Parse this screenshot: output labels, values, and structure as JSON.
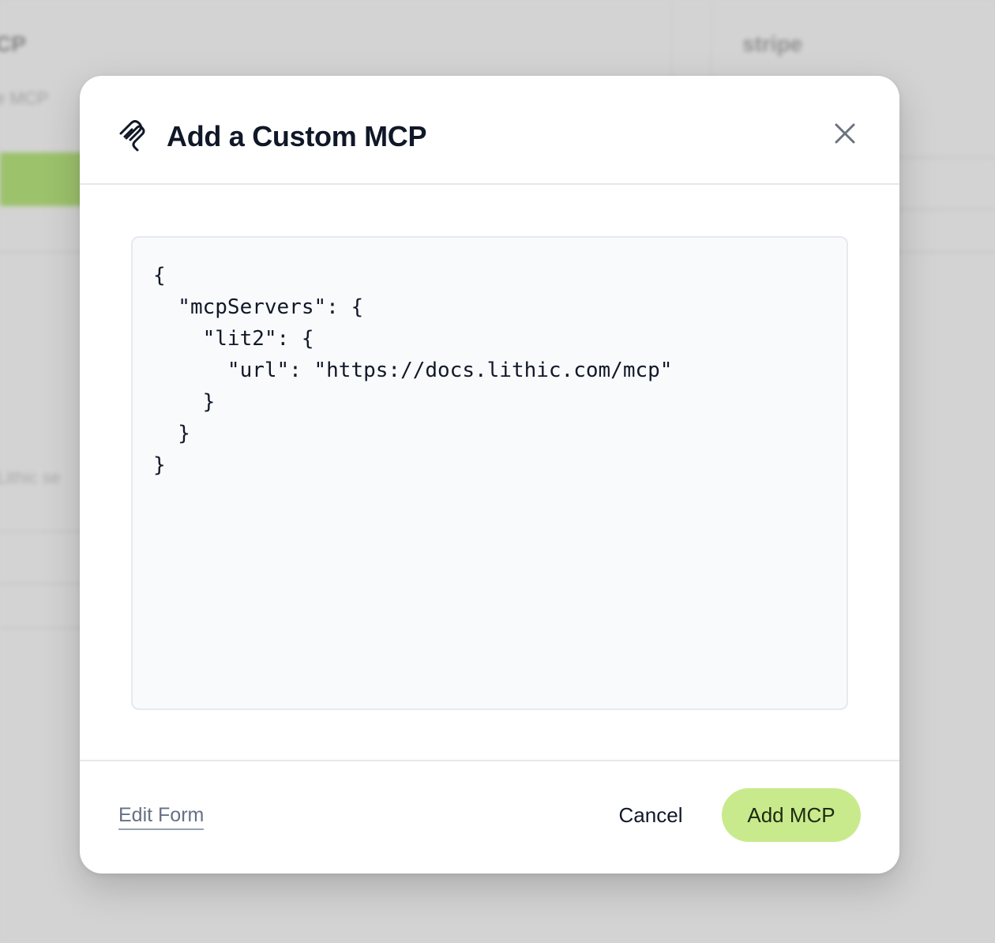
{
  "background": {
    "left_heading": "CP",
    "left_subtext": "e MCP",
    "right_heading": "stripe",
    "faint_text": "Lithic se"
  },
  "modal": {
    "title": "Add a Custom MCP",
    "header_icon": "mcp-logo-icon",
    "close_icon": "close-icon",
    "config_json": "{\n  \"mcpServers\": {\n    \"lit2\": {\n      \"url\": \"https://docs.lithic.com/mcp\"\n    }\n  }\n}",
    "footer": {
      "edit_form_label": "Edit Form",
      "cancel_label": "Cancel",
      "submit_label": "Add MCP"
    }
  },
  "colors": {
    "accent_button": "#c9ea8c",
    "title_text": "#101828",
    "link_text": "#667085",
    "backdrop": "#d1d1d1"
  }
}
